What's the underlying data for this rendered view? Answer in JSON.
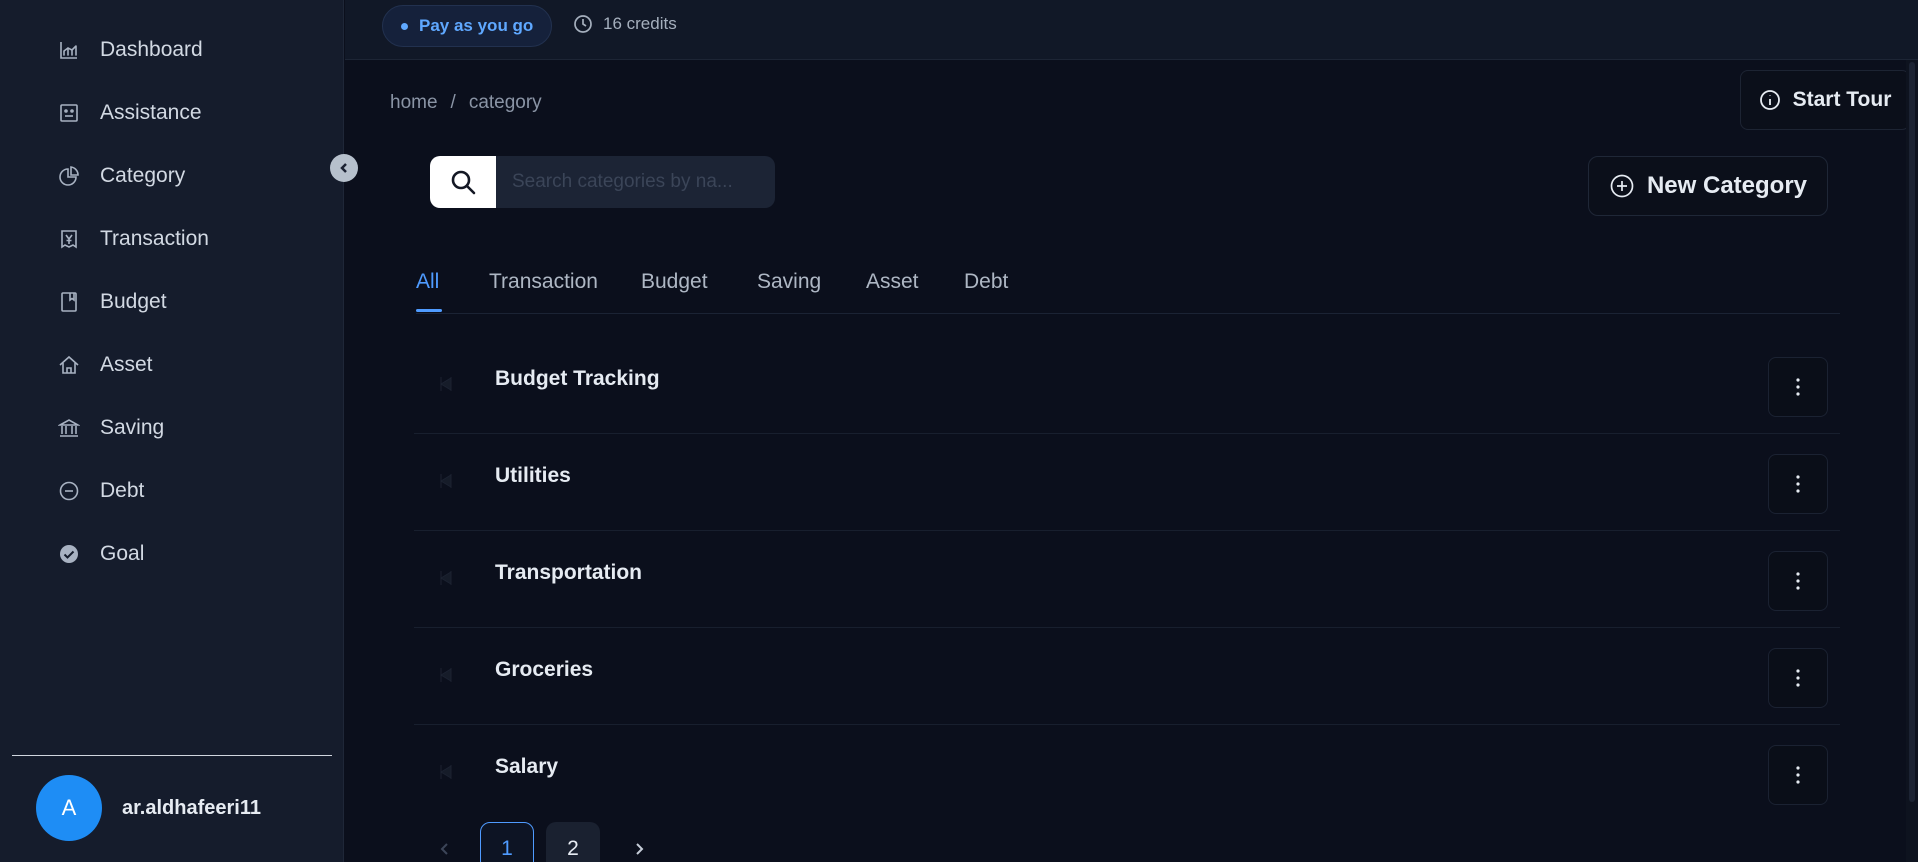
{
  "sidebar": {
    "items": [
      {
        "label": "Dashboard",
        "icon": "chart-icon"
      },
      {
        "label": "Assistance",
        "icon": "robot-icon"
      },
      {
        "label": "Category",
        "icon": "pie-chart-icon"
      },
      {
        "label": "Transaction",
        "icon": "yen-receipt-icon"
      },
      {
        "label": "Budget",
        "icon": "book-icon"
      },
      {
        "label": "Asset",
        "icon": "home-icon"
      },
      {
        "label": "Saving",
        "icon": "bank-icon"
      },
      {
        "label": "Debt",
        "icon": "minus-circle-icon"
      },
      {
        "label": "Goal",
        "icon": "check-circle-icon"
      }
    ],
    "user": {
      "initial": "A",
      "name": "ar.aldhafeeri11"
    }
  },
  "topbar": {
    "plan": "Pay as you go",
    "credits": "16 credits"
  },
  "breadcrumb": {
    "home": "home",
    "separator": "/",
    "current": "category"
  },
  "actions": {
    "start_tour": "Start Tour",
    "new_category": "New Category"
  },
  "search": {
    "placeholder": "Search categories by na..."
  },
  "tabs": [
    "All",
    "Transaction",
    "Budget",
    "Saving",
    "Asset",
    "Debt"
  ],
  "active_tab": "All",
  "categories": [
    "Budget Tracking",
    "Utilities",
    "Transportation",
    "Groceries",
    "Salary"
  ],
  "pagination": {
    "pages": [
      "1",
      "2"
    ],
    "current": "1"
  },
  "colors": {
    "accent": "#4f9bff",
    "avatar": "#1e8df5",
    "background": "#0b0f1c",
    "sidebar": "#151c2c"
  }
}
